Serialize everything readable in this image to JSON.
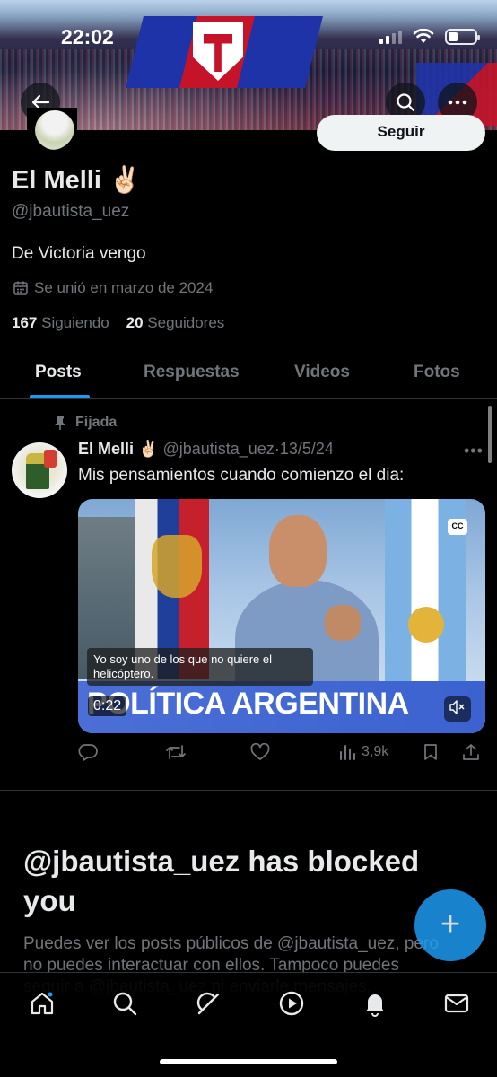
{
  "status": {
    "time": "22:02"
  },
  "profile": {
    "follow_label": "Seguir",
    "name": "El Melli ✌🏻",
    "handle": "@jbautista_uez",
    "bio": "De Victoria vengo",
    "joined": "Se unió en marzo de 2024",
    "following_count": "167",
    "following_label": "Siguiendo",
    "followers_count": "20",
    "followers_label": "Seguidores"
  },
  "tabs": [
    {
      "label": "Posts",
      "active": true
    },
    {
      "label": "Respuestas",
      "active": false
    },
    {
      "label": "Videos",
      "active": false
    },
    {
      "label": "Fotos",
      "active": false
    }
  ],
  "post": {
    "pinned_label": "Fijada",
    "author": "El Melli ✌🏻",
    "handle": "@jbautista_uez",
    "separator": "·",
    "date": "13/5/24",
    "text": "Mis pensamientos cuando comienzo el dia:",
    "media": {
      "banner_text": "POLÍTICA ARGENTINA",
      "caption": "Yo soy uno de los que no quiere el helicóptero.",
      "duration": "0:22",
      "cc_label": "CC"
    },
    "views": "3,9k"
  },
  "blocked": {
    "title": "@jbautista_uez has blocked you",
    "description": "Puedes ver los posts públicos de @jbautista_uez, pero no puedes interactuar con ellos. Tampoco puedes seguir a @jbautista_uez ni enviarle mensajes."
  },
  "colors": {
    "accent": "#1d9bf0",
    "background": "#000000",
    "muted": "#71767b",
    "text": "#e7e9ea"
  }
}
